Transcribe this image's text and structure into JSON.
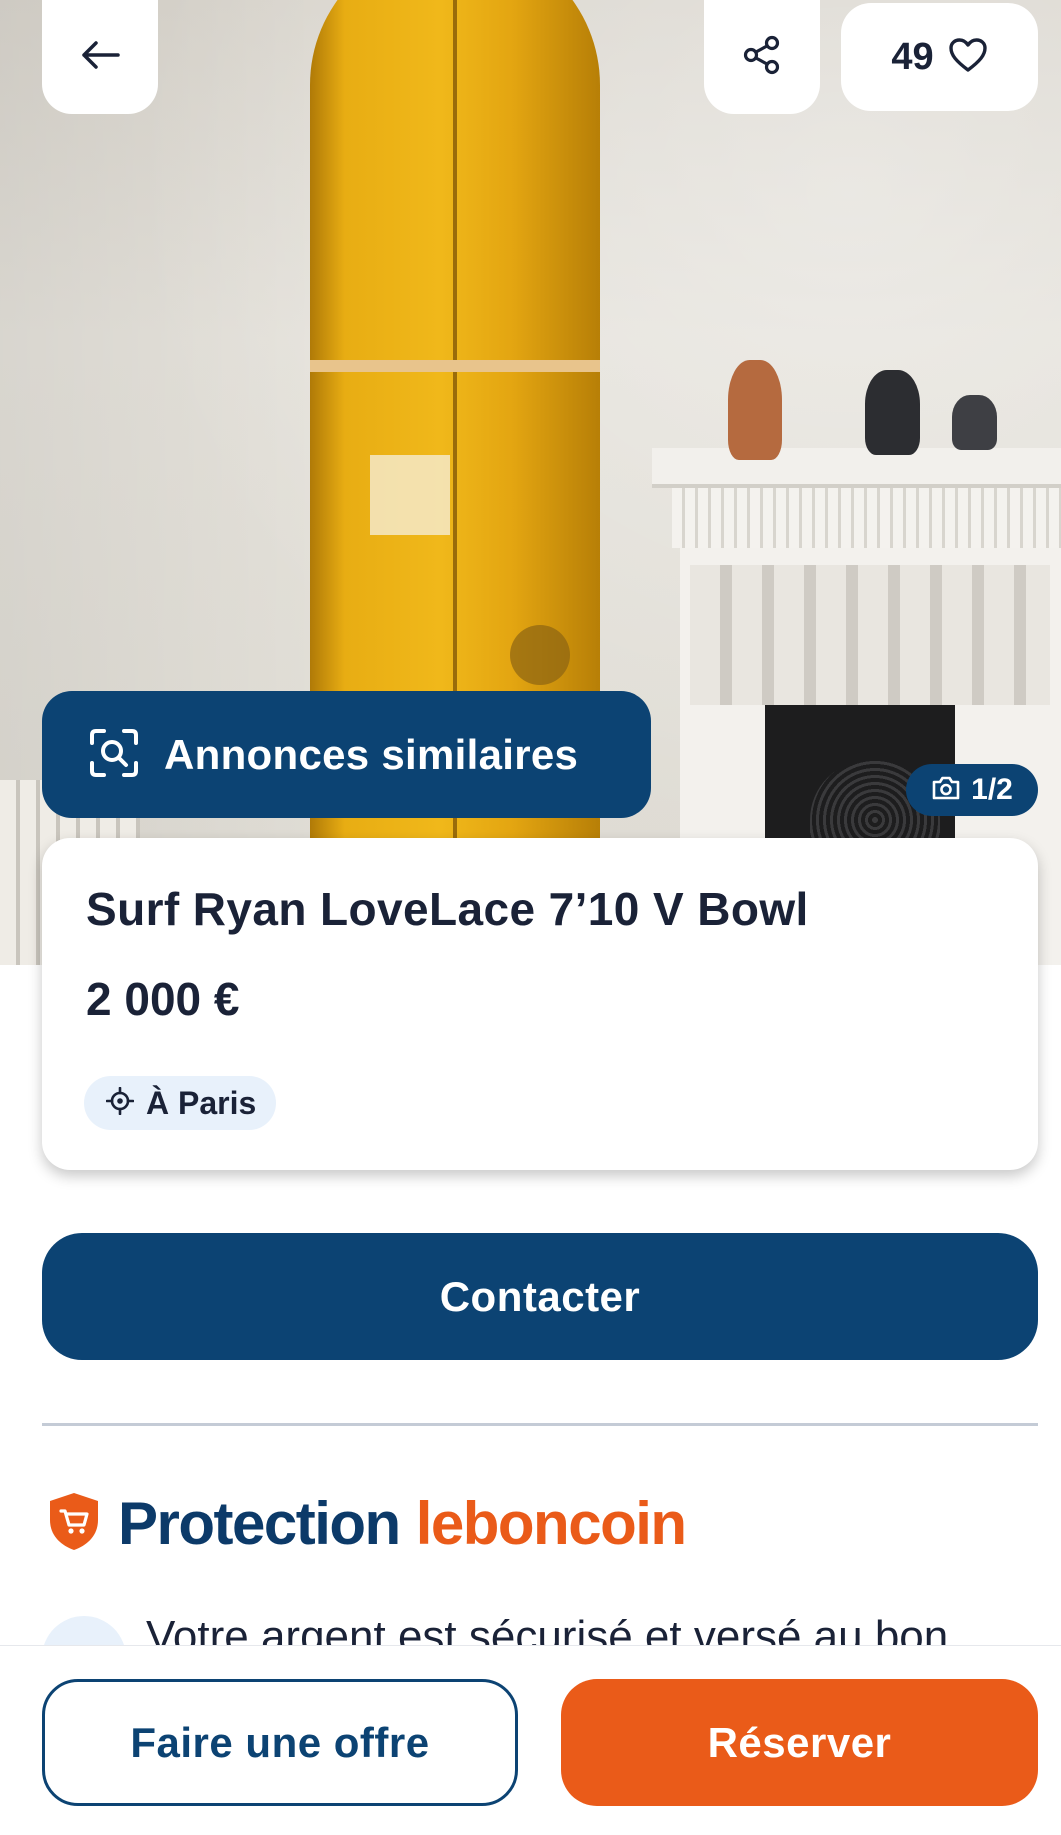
{
  "gallery": {
    "counter": "1/2",
    "similar_label": "Annonces similaires"
  },
  "header": {
    "favorites_count": "49"
  },
  "ad": {
    "title": "Surf Ryan LoveLace 7’10 V Bowl",
    "price": "2 000 €",
    "location": "À Paris"
  },
  "actions": {
    "contact_label": "Contacter",
    "offer_label": "Faire une offre",
    "reserve_label": "Réserver"
  },
  "protection": {
    "title_word": "Protection",
    "brand": "leboncoin",
    "secure_text": "Votre argent est sécurisé et versé au bon"
  },
  "icons": {
    "back": "arrow-left-icon",
    "share": "share-icon",
    "favorite": "heart-icon",
    "similar": "visual-search-icon",
    "camera": "camera-icon",
    "location": "location-target-icon",
    "protection": "shield-cart-icon"
  },
  "colors": {
    "primary": "#0c4373",
    "accent": "#ea5b19",
    "text": "#1a2237",
    "chip_bg": "#e8f1fb"
  }
}
